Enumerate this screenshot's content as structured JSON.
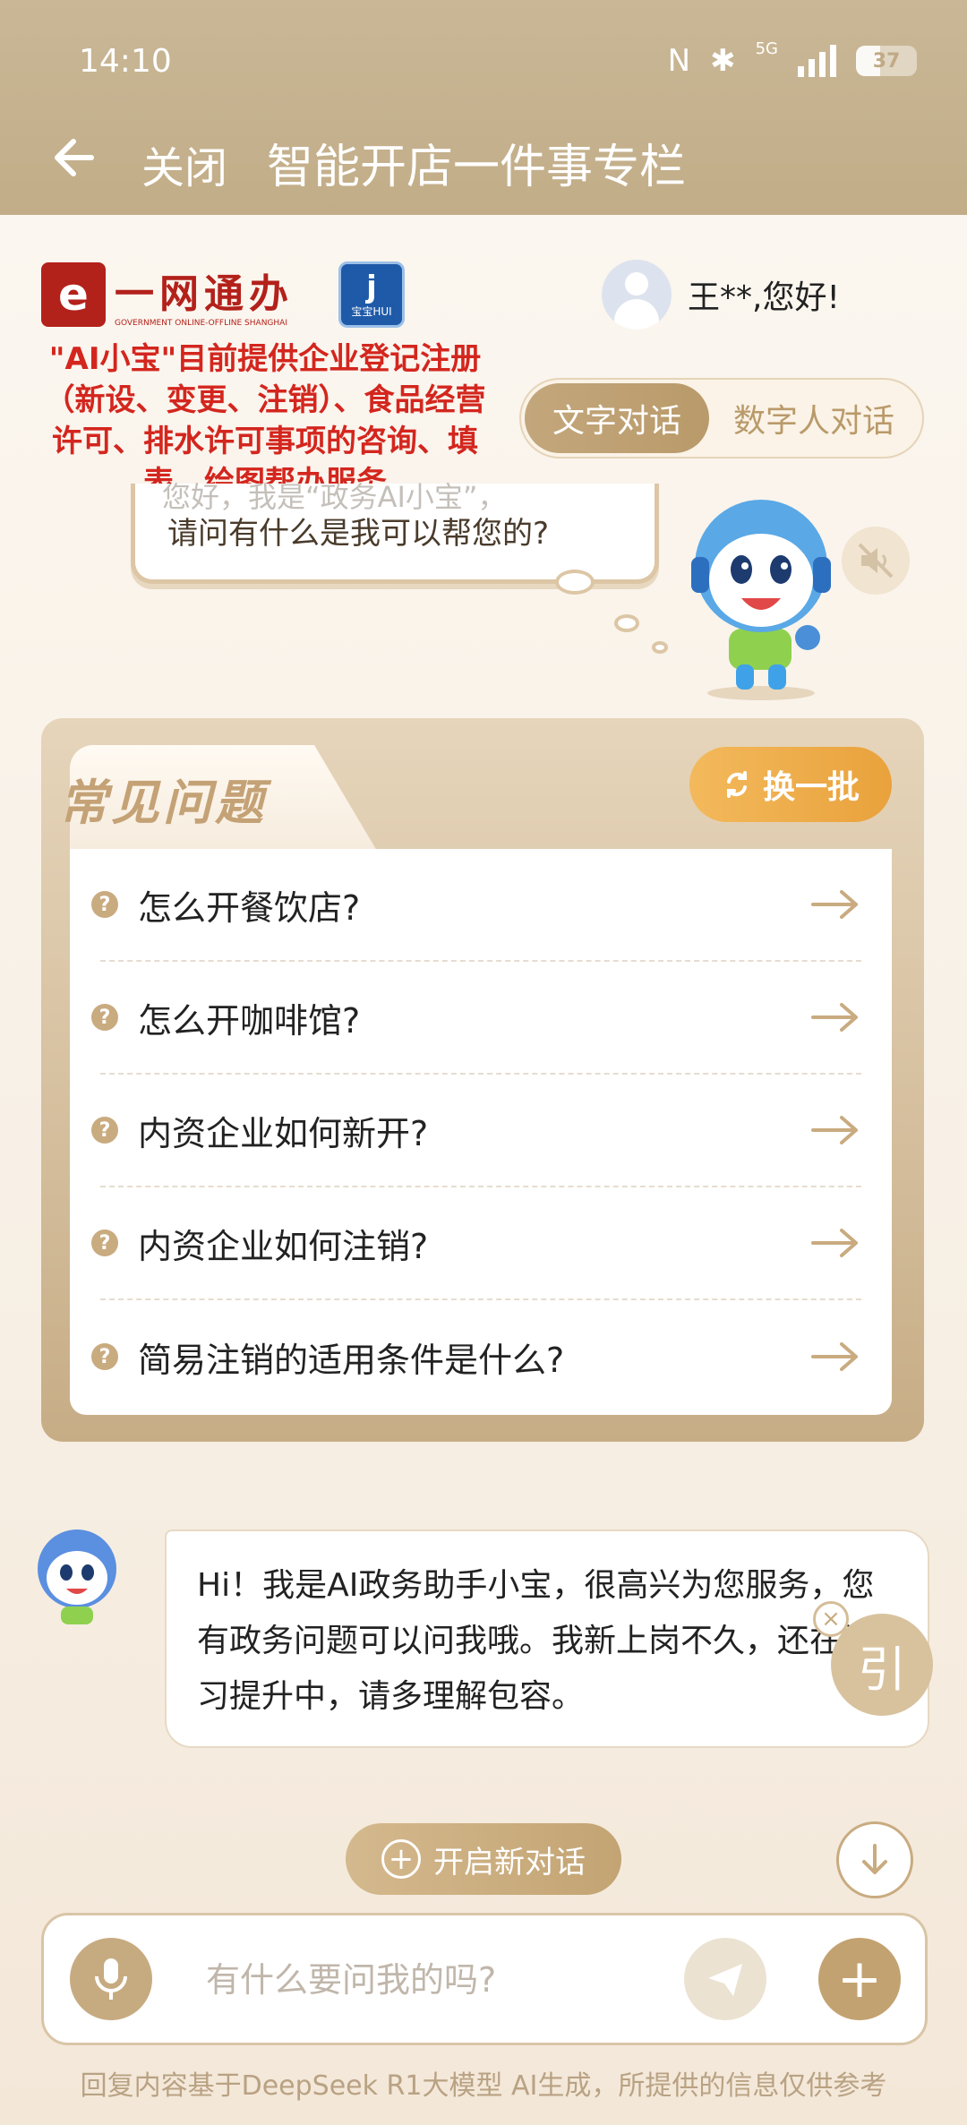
{
  "status": {
    "time": "14:10",
    "network": "5G",
    "battery": "37"
  },
  "nav": {
    "close_label": "关闭",
    "title": "智能开店一件事专栏"
  },
  "branding": {
    "logo_mark": "e",
    "logo_text": "一网通办",
    "logo_subtext": "GOVERNMENT ONLINE-OFFLINE SHANGHAI",
    "baohui_label": "宝宝HUI"
  },
  "notice": "\"AI小宝\"目前提供企业登记注册（新设、变更、注销）、食品经营许可、排水许可事项的咨询、填表、绘图帮办服务",
  "user": {
    "greeting": "王**,您好!"
  },
  "modes": {
    "text": "文字对话",
    "digital": "数字人对话",
    "active": "text"
  },
  "welcome": {
    "peek": "您好，我是“政务AI小宝”，",
    "question": "请问有什么是我可以帮您的?"
  },
  "faq": {
    "title": "常见问题",
    "refresh_label": "换一批",
    "items": [
      "怎么开餐饮店?",
      "怎么开咖啡馆?",
      "内资企业如何新开?",
      "内资企业如何注销?",
      "简易注销的适用条件是什么?"
    ]
  },
  "chat": {
    "message": "Hi！我是AI政务助手小宝，很高兴为您服务，您有政务问题可以问我哦。我新上岗不久，还在学习提升中，请多理解包容。",
    "ref_label": "引"
  },
  "new_chat_label": "开启新对话",
  "input": {
    "placeholder": "有什么要问我的吗?",
    "value": ""
  },
  "disclaimer": "回复内容基于DeepSeek R1大模型 AI生成，所提供的信息仅供参考",
  "colors": {
    "accent": "#c3a271",
    "header": "#c5b08c",
    "notice_red": "#d3261e",
    "refresh": "#eea845"
  }
}
